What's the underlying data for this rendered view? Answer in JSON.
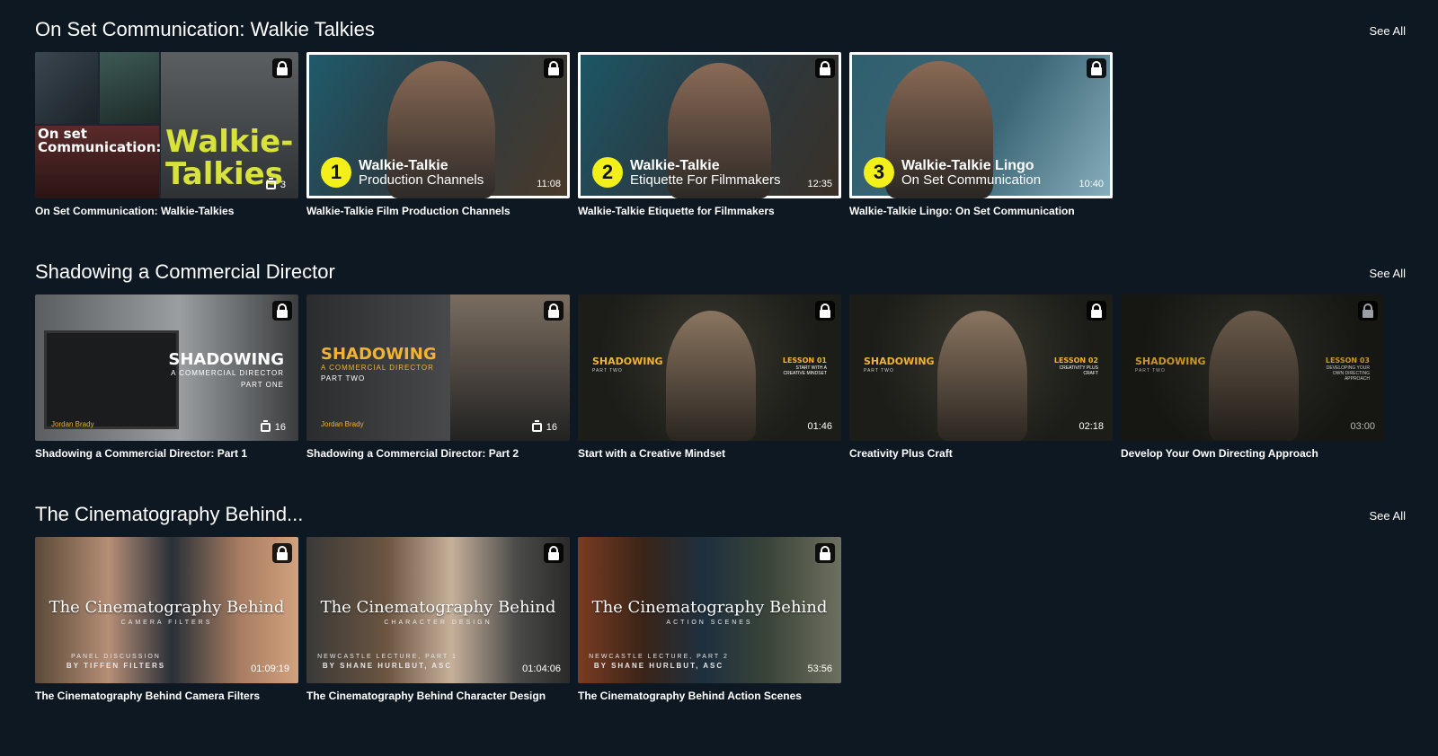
{
  "rows": [
    {
      "title": "On Set Communication: Walkie Talkies",
      "see_all": "See All",
      "cards": [
        {
          "title": "On Set Communication: Walkie-Talkies",
          "count": "3",
          "overlay_line1": "On set",
          "overlay_line2": "Communication:",
          "overlay_word1": "Walkie-",
          "overlay_word2": "Talkies"
        },
        {
          "title": "Walkie-Talkie Film Production Channels",
          "number": "1",
          "ep_line1": "Walkie-Talkie",
          "ep_line2": "Production Channels",
          "duration": "11:08"
        },
        {
          "title": "Walkie-Talkie Etiquette for Filmmakers",
          "number": "2",
          "ep_line1": "Walkie-Talkie",
          "ep_line2": "Etiquette For Filmmakers",
          "duration": "12:35"
        },
        {
          "title": "Walkie-Talkie Lingo: On Set Communication",
          "number": "3",
          "ep_line1": "Walkie-Talkie Lingo",
          "ep_line2": "On Set Communication",
          "duration": "10:40"
        }
      ]
    },
    {
      "title": "Shadowing a Commercial Director",
      "see_all": "See All",
      "cards": [
        {
          "title": "Shadowing a Commercial Director: Part 1",
          "count": "16",
          "overlay_main": "SHADOWING",
          "overlay_sub": "A COMMERCIAL DIRECTOR",
          "overlay_part": "PART ONE",
          "overlay_name": "Jordan Brady"
        },
        {
          "title": "Shadowing a Commercial Director: Part 2",
          "count": "16",
          "overlay_main": "SHADOWING",
          "overlay_sub": "A COMMERCIAL DIRECTOR",
          "overlay_part": "PART TWO",
          "overlay_name": "Jordan Brady"
        },
        {
          "title": "Start with a Creative Mindset",
          "duration": "01:46",
          "overlay_main": "SHADOWING",
          "overlay_part": "PART TWO",
          "lesson": "LESSON 01",
          "lesson_sub": "START WITH A CREATIVE MINDSET"
        },
        {
          "title": "Creativity Plus Craft",
          "duration": "02:18",
          "overlay_main": "SHADOWING",
          "overlay_part": "PART TWO",
          "lesson": "LESSON 02",
          "lesson_sub": "CREATIVITY PLUS CRAFT"
        },
        {
          "title": "Develop Your Own Directing Approach",
          "duration": "03:00",
          "overlay_main": "SHADOWING",
          "overlay_part": "PART TWO",
          "lesson": "LESSON 03",
          "lesson_sub": "DEVELOPING YOUR OWN DIRECTING APPROACH"
        }
      ]
    },
    {
      "title": "The Cinematography Behind...",
      "see_all": "See All",
      "cards": [
        {
          "title": "The Cinematography Behind Camera Filters",
          "duration": "01:09:19",
          "overlay_title": "The Cinematography Behind",
          "overlay_sub": "CAMERA FILTERS",
          "overlay_top": "PANEL DISCUSSION",
          "overlay_by": "BY TIFFEN FILTERS"
        },
        {
          "title": "The Cinematography Behind Character Design",
          "duration": "01:04:06",
          "overlay_title": "The Cinematography Behind",
          "overlay_sub": "CHARACTER DESIGN",
          "overlay_top": "NEWCASTLE LECTURE, PART 1",
          "overlay_by": "BY SHANE HURLBUT, ASC"
        },
        {
          "title": "The Cinematography Behind Action Scenes",
          "duration": "53:56",
          "overlay_title": "The Cinematography Behind",
          "overlay_sub": "ACTION SCENES",
          "overlay_top": "NEWCASTLE LECTURE, PART 2",
          "overlay_by": "BY SHANE HURLBUT, ASC"
        }
      ]
    }
  ]
}
